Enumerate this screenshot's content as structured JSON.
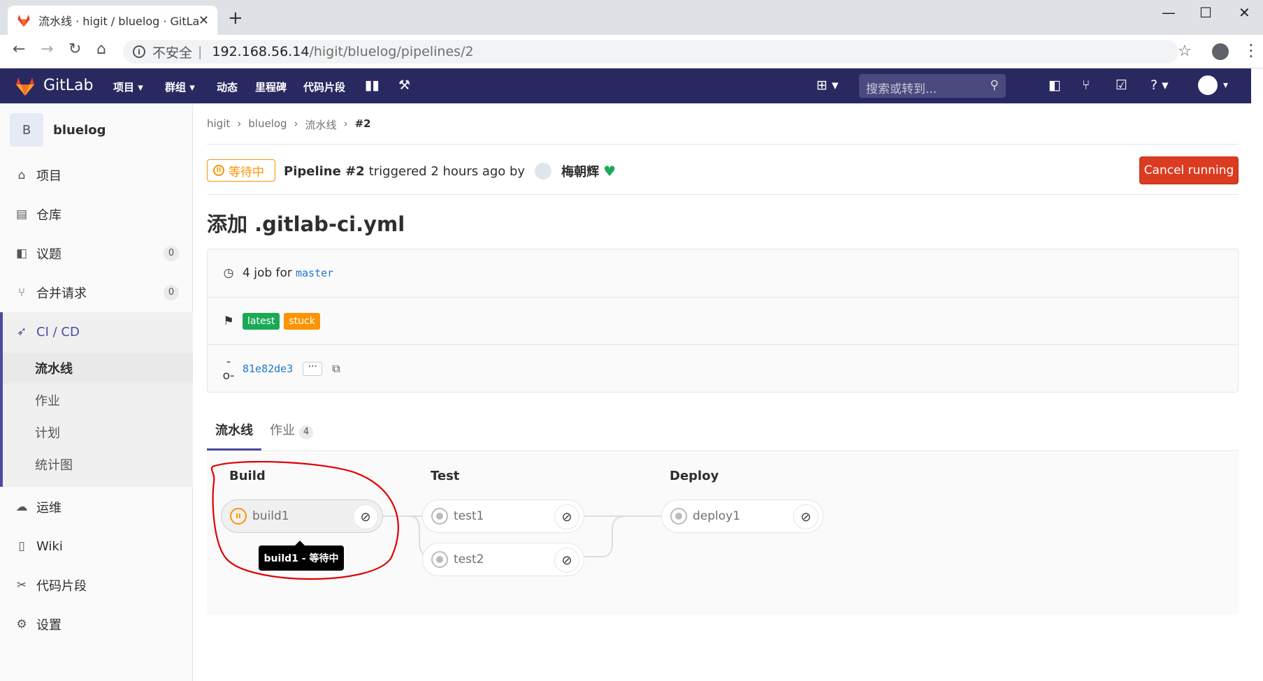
{
  "browser": {
    "tab_title": "流水线 · higit / bluelog · GitLab",
    "tab_close": "✕",
    "new_tab": "+",
    "insecure_label": "不安全",
    "url_host": "192.168.56.14",
    "url_path": "/higit/bluelog/pipelines/2"
  },
  "header": {
    "brand": "GitLab",
    "nav": [
      "项目",
      "群组",
      "动态",
      "里程碑",
      "代码片段"
    ],
    "search_placeholder": "搜索或转到..."
  },
  "sidebar": {
    "project_initial": "B",
    "project_name": "bluelog",
    "items": [
      {
        "label": "项目",
        "icon": "home-icon"
      },
      {
        "label": "仓库",
        "icon": "doc-icon"
      },
      {
        "label": "议题",
        "icon": "issues-icon",
        "count": "0"
      },
      {
        "label": "合并请求",
        "icon": "merge-request-icon",
        "count": "0"
      },
      {
        "label": "CI / CD",
        "icon": "rocket-icon"
      },
      {
        "label": "运维",
        "icon": "cloud-gear-icon"
      },
      {
        "label": "Wiki",
        "icon": "book-icon"
      },
      {
        "label": "代码片段",
        "icon": "scissors-icon"
      },
      {
        "label": "设置",
        "icon": "gear-icon"
      }
    ],
    "cicd_sub": [
      "流水线",
      "作业",
      "计划",
      "统计图"
    ]
  },
  "breadcrumb": [
    "higit",
    "bluelog",
    "流水线",
    "#2"
  ],
  "pipeline": {
    "status": "等待中",
    "title": "Pipeline #2",
    "triggered_text": "triggered 2 hours ago by",
    "user": "梅朝辉",
    "cancel_label": "Cancel running",
    "commit_title": "添加 .gitlab-ci.yml",
    "jobs_text": "4 job for",
    "branch": "master",
    "labels": [
      "latest",
      "stuck"
    ],
    "commit_sha": "81e82de3",
    "dots": "···"
  },
  "tabs": [
    {
      "label": "流水线"
    },
    {
      "label": "作业",
      "count": "4"
    }
  ],
  "stages": [
    {
      "name": "Build",
      "jobs": [
        "build1"
      ]
    },
    {
      "name": "Test",
      "jobs": [
        "test1",
        "test2"
      ]
    },
    {
      "name": "Deploy",
      "jobs": [
        "deploy1"
      ]
    }
  ],
  "tooltip": "build1 - 等待中",
  "colors": {
    "header_bg": "#292961",
    "pending": "#fc9403",
    "cancel": "#db3b21",
    "success": "#1aaa55",
    "annotation": "#e00000"
  }
}
